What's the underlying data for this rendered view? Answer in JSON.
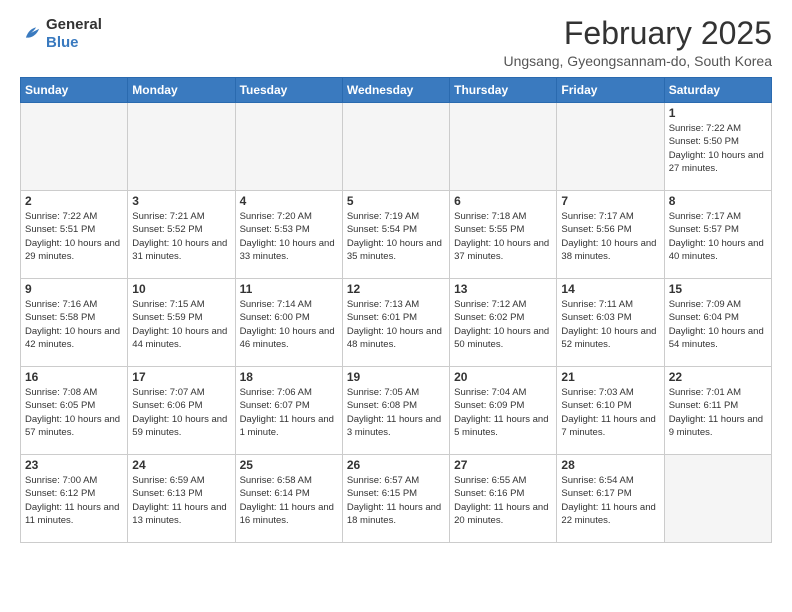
{
  "header": {
    "logo": {
      "line1": "General",
      "line2": "Blue"
    },
    "month": "February 2025",
    "location": "Ungsang, Gyeongsannam-do, South Korea"
  },
  "weekdays": [
    "Sunday",
    "Monday",
    "Tuesday",
    "Wednesday",
    "Thursday",
    "Friday",
    "Saturday"
  ],
  "weeks": [
    [
      {
        "day": "",
        "empty": true
      },
      {
        "day": "",
        "empty": true
      },
      {
        "day": "",
        "empty": true
      },
      {
        "day": "",
        "empty": true
      },
      {
        "day": "",
        "empty": true
      },
      {
        "day": "",
        "empty": true
      },
      {
        "day": "1",
        "sunrise": "7:22 AM",
        "sunset": "5:50 PM",
        "daylight": "10 hours and 27 minutes."
      }
    ],
    [
      {
        "day": "2",
        "sunrise": "7:22 AM",
        "sunset": "5:51 PM",
        "daylight": "10 hours and 29 minutes."
      },
      {
        "day": "3",
        "sunrise": "7:21 AM",
        "sunset": "5:52 PM",
        "daylight": "10 hours and 31 minutes."
      },
      {
        "day": "4",
        "sunrise": "7:20 AM",
        "sunset": "5:53 PM",
        "daylight": "10 hours and 33 minutes."
      },
      {
        "day": "5",
        "sunrise": "7:19 AM",
        "sunset": "5:54 PM",
        "daylight": "10 hours and 35 minutes."
      },
      {
        "day": "6",
        "sunrise": "7:18 AM",
        "sunset": "5:55 PM",
        "daylight": "10 hours and 37 minutes."
      },
      {
        "day": "7",
        "sunrise": "7:17 AM",
        "sunset": "5:56 PM",
        "daylight": "10 hours and 38 minutes."
      },
      {
        "day": "8",
        "sunrise": "7:17 AM",
        "sunset": "5:57 PM",
        "daylight": "10 hours and 40 minutes."
      }
    ],
    [
      {
        "day": "9",
        "sunrise": "7:16 AM",
        "sunset": "5:58 PM",
        "daylight": "10 hours and 42 minutes."
      },
      {
        "day": "10",
        "sunrise": "7:15 AM",
        "sunset": "5:59 PM",
        "daylight": "10 hours and 44 minutes."
      },
      {
        "day": "11",
        "sunrise": "7:14 AM",
        "sunset": "6:00 PM",
        "daylight": "10 hours and 46 minutes."
      },
      {
        "day": "12",
        "sunrise": "7:13 AM",
        "sunset": "6:01 PM",
        "daylight": "10 hours and 48 minutes."
      },
      {
        "day": "13",
        "sunrise": "7:12 AM",
        "sunset": "6:02 PM",
        "daylight": "10 hours and 50 minutes."
      },
      {
        "day": "14",
        "sunrise": "7:11 AM",
        "sunset": "6:03 PM",
        "daylight": "10 hours and 52 minutes."
      },
      {
        "day": "15",
        "sunrise": "7:09 AM",
        "sunset": "6:04 PM",
        "daylight": "10 hours and 54 minutes."
      }
    ],
    [
      {
        "day": "16",
        "sunrise": "7:08 AM",
        "sunset": "6:05 PM",
        "daylight": "10 hours and 57 minutes."
      },
      {
        "day": "17",
        "sunrise": "7:07 AM",
        "sunset": "6:06 PM",
        "daylight": "10 hours and 59 minutes."
      },
      {
        "day": "18",
        "sunrise": "7:06 AM",
        "sunset": "6:07 PM",
        "daylight": "11 hours and 1 minute."
      },
      {
        "day": "19",
        "sunrise": "7:05 AM",
        "sunset": "6:08 PM",
        "daylight": "11 hours and 3 minutes."
      },
      {
        "day": "20",
        "sunrise": "7:04 AM",
        "sunset": "6:09 PM",
        "daylight": "11 hours and 5 minutes."
      },
      {
        "day": "21",
        "sunrise": "7:03 AM",
        "sunset": "6:10 PM",
        "daylight": "11 hours and 7 minutes."
      },
      {
        "day": "22",
        "sunrise": "7:01 AM",
        "sunset": "6:11 PM",
        "daylight": "11 hours and 9 minutes."
      }
    ],
    [
      {
        "day": "23",
        "sunrise": "7:00 AM",
        "sunset": "6:12 PM",
        "daylight": "11 hours and 11 minutes."
      },
      {
        "day": "24",
        "sunrise": "6:59 AM",
        "sunset": "6:13 PM",
        "daylight": "11 hours and 13 minutes."
      },
      {
        "day": "25",
        "sunrise": "6:58 AM",
        "sunset": "6:14 PM",
        "daylight": "11 hours and 16 minutes."
      },
      {
        "day": "26",
        "sunrise": "6:57 AM",
        "sunset": "6:15 PM",
        "daylight": "11 hours and 18 minutes."
      },
      {
        "day": "27",
        "sunrise": "6:55 AM",
        "sunset": "6:16 PM",
        "daylight": "11 hours and 20 minutes."
      },
      {
        "day": "28",
        "sunrise": "6:54 AM",
        "sunset": "6:17 PM",
        "daylight": "11 hours and 22 minutes."
      },
      {
        "day": "",
        "empty": true
      }
    ]
  ]
}
